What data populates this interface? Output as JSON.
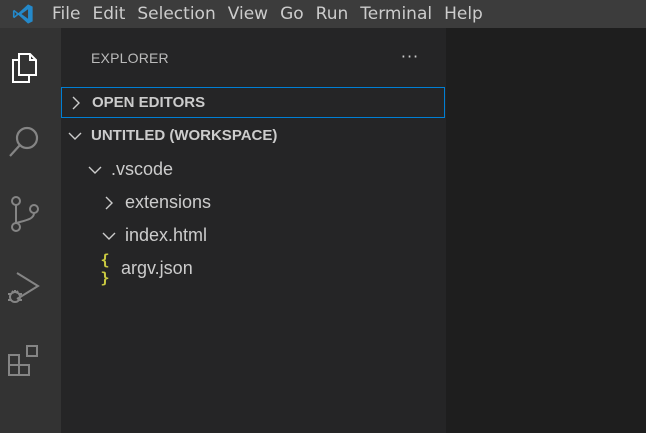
{
  "menu": {
    "items": [
      "File",
      "Edit",
      "Selection",
      "View",
      "Go",
      "Run",
      "Terminal",
      "Help"
    ]
  },
  "activity_bar": {
    "icons": [
      "files-icon",
      "search-icon",
      "source-control-icon",
      "run-debug-icon",
      "extensions-icon"
    ]
  },
  "sidebar": {
    "title": "EXPLORER",
    "more_actions": "···",
    "sections": {
      "open_editors": "OPEN EDITORS",
      "workspace": "UNTITLED (WORKSPACE)"
    },
    "tree": {
      "vscode_folder": ".vscode",
      "extensions_folder": "extensions",
      "index_folder": "index.html",
      "argv_file": "argv.json",
      "json_icon_glyph": "{ }"
    }
  },
  "colors": {
    "accent": "#007fd4",
    "vscode_blue": "#2489ca",
    "json_icon": "#cbcb41"
  }
}
